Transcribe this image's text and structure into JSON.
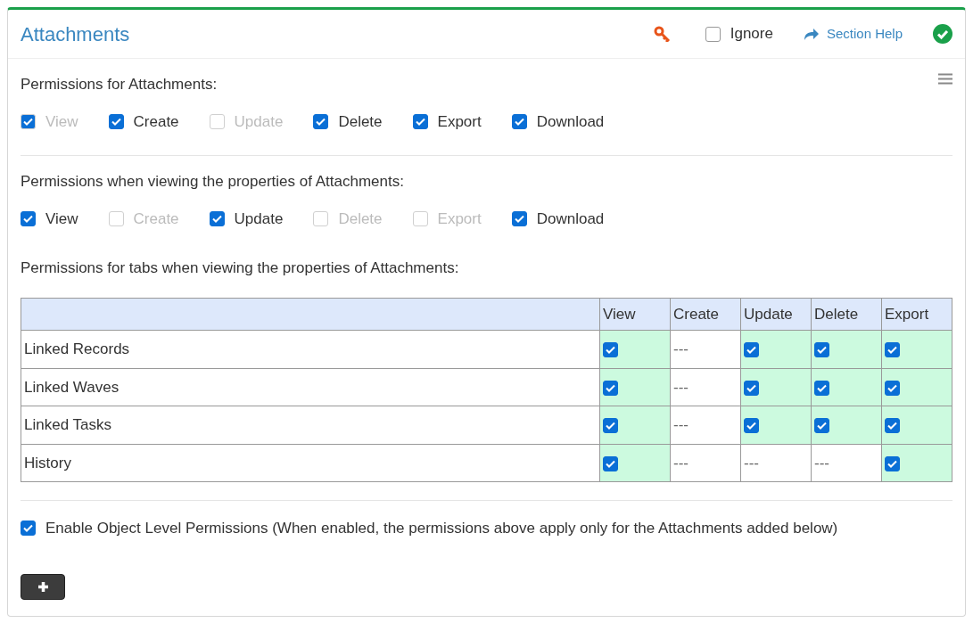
{
  "header": {
    "title": "Attachments",
    "ignore": {
      "label": "Ignore",
      "checked": false
    },
    "help": "Section Help",
    "complete": true
  },
  "groups": [
    {
      "label": "Permissions for Attachments:",
      "menu": true,
      "items": [
        {
          "label": "View",
          "checked": true,
          "disabled": true
        },
        {
          "label": "Create",
          "checked": true,
          "disabled": false
        },
        {
          "label": "Update",
          "checked": false,
          "disabled": true
        },
        {
          "label": "Delete",
          "checked": true,
          "disabled": false
        },
        {
          "label": "Export",
          "checked": true,
          "disabled": false
        },
        {
          "label": "Download",
          "checked": true,
          "disabled": false
        }
      ]
    },
    {
      "label": "Permissions when viewing the properties of Attachments:",
      "menu": false,
      "items": [
        {
          "label": "View",
          "checked": true,
          "disabled": false
        },
        {
          "label": "Create",
          "checked": false,
          "disabled": true
        },
        {
          "label": "Update",
          "checked": true,
          "disabled": false
        },
        {
          "label": "Delete",
          "checked": false,
          "disabled": true
        },
        {
          "label": "Export",
          "checked": false,
          "disabled": true
        },
        {
          "label": "Download",
          "checked": true,
          "disabled": false
        }
      ]
    }
  ],
  "tabs_label": "Permissions for tabs when viewing the properties of Attachments:",
  "table": {
    "columns": [
      "View",
      "Create",
      "Update",
      "Delete",
      "Export"
    ],
    "rows": [
      {
        "name": "Linked Records",
        "cells": [
          {
            "kind": "checkbox",
            "checked": true
          },
          {
            "kind": "text",
            "text": "---"
          },
          {
            "kind": "checkbox",
            "checked": true
          },
          {
            "kind": "checkbox",
            "checked": true
          },
          {
            "kind": "checkbox",
            "checked": true
          }
        ]
      },
      {
        "name": "Linked Waves",
        "cells": [
          {
            "kind": "checkbox",
            "checked": true
          },
          {
            "kind": "text",
            "text": "---"
          },
          {
            "kind": "checkbox",
            "checked": true
          },
          {
            "kind": "checkbox",
            "checked": true
          },
          {
            "kind": "checkbox",
            "checked": true
          }
        ]
      },
      {
        "name": "Linked Tasks",
        "cells": [
          {
            "kind": "checkbox",
            "checked": true
          },
          {
            "kind": "text",
            "text": "---"
          },
          {
            "kind": "checkbox",
            "checked": true
          },
          {
            "kind": "checkbox",
            "checked": true
          },
          {
            "kind": "checkbox",
            "checked": true
          }
        ]
      },
      {
        "name": "History",
        "cells": [
          {
            "kind": "checkbox",
            "checked": true
          },
          {
            "kind": "text",
            "text": "---"
          },
          {
            "kind": "text",
            "text": "---"
          },
          {
            "kind": "text",
            "text": "---"
          },
          {
            "kind": "checkbox",
            "checked": true
          }
        ]
      }
    ]
  },
  "object_level": {
    "label": "Enable Object Level Permissions (When enabled, the permissions above apply only for the Attachments added below)",
    "checked": true
  }
}
